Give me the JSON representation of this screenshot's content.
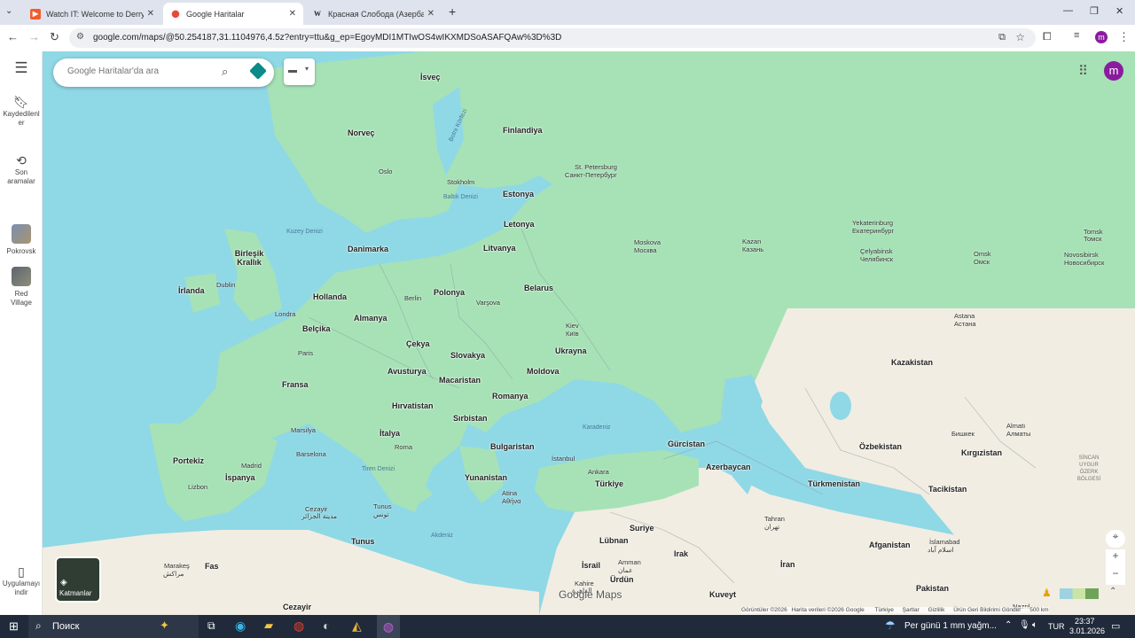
{
  "tabs": [
    {
      "title": "Watch IT: Welcome to Derry Se",
      "active": false
    },
    {
      "title": "Google Haritalar",
      "active": true
    },
    {
      "title": "Красная Слобода (Азербайдж",
      "active": false
    }
  ],
  "address": {
    "url": "google.com/maps/@50.254187,31.1104976,4.5z?entry=ttu&g_ep=EgoyMDI1MTIwOS4wIKXMDSoASAFQAw%3D%3D"
  },
  "search": {
    "placeholder": "Google Haritalar'da ara"
  },
  "rail": {
    "menu": "",
    "saved": "Kaydedilenler",
    "recent": "Son aramalar",
    "pokrovsk": "Pokrovsk",
    "redvillage": "Red Village",
    "getapp": "Uygulamayı indir"
  },
  "account_initial": "m",
  "layers_label": "Katmanlar",
  "map": {
    "countries": [
      {
        "name": "İsveç"
      },
      {
        "name": "Norveç"
      },
      {
        "name": "Finlandiya"
      },
      {
        "name": "Estonya"
      },
      {
        "name": "Letonya"
      },
      {
        "name": "Litvanya"
      },
      {
        "name": "Danimarka"
      },
      {
        "name": "Birleşik Krallık"
      },
      {
        "name": "İrlanda"
      },
      {
        "name": "Hollanda"
      },
      {
        "name": "Polonya"
      },
      {
        "name": "Belarus"
      },
      {
        "name": "Almanya"
      },
      {
        "name": "Belçika"
      },
      {
        "name": "Çekya"
      },
      {
        "name": "Slovakya"
      },
      {
        "name": "Ukrayna"
      },
      {
        "name": "Fransa"
      },
      {
        "name": "Avusturya"
      },
      {
        "name": "Macaristan"
      },
      {
        "name": "Moldova"
      },
      {
        "name": "Romanya"
      },
      {
        "name": "Hırvatistan"
      },
      {
        "name": "Sırbistan"
      },
      {
        "name": "İtalya"
      },
      {
        "name": "Bulgaristan"
      },
      {
        "name": "Portekiz"
      },
      {
        "name": "İspanya"
      },
      {
        "name": "Yunanistan"
      },
      {
        "name": "Türkiye"
      },
      {
        "name": "Gürcistan"
      },
      {
        "name": "Azerbaycan"
      },
      {
        "name": "Kazakistan"
      },
      {
        "name": "Özbekistan"
      },
      {
        "name": "Kırgızistan"
      },
      {
        "name": "Türkmenistan"
      },
      {
        "name": "Tacikistan"
      },
      {
        "name": "Suriye"
      },
      {
        "name": "Irak"
      },
      {
        "name": "İran"
      },
      {
        "name": "Afganistan"
      },
      {
        "name": "Pakistan"
      },
      {
        "name": "Tunus"
      },
      {
        "name": "Lübnan"
      },
      {
        "name": "İsrail"
      },
      {
        "name": "Ürdün"
      },
      {
        "name": "Kuveyt"
      },
      {
        "name": "Fas"
      },
      {
        "name": "Cezayir"
      }
    ],
    "cities": [
      {
        "name": "Oslo"
      },
      {
        "name": "Stokholm"
      },
      {
        "name": "St. Petersburg"
      },
      {
        "name": "Санкт-Петербург"
      },
      {
        "name": "Moskova"
      },
      {
        "name": "Москва"
      },
      {
        "name": "Kazan"
      },
      {
        "name": "Казань"
      },
      {
        "name": "Yekaterinburg"
      },
      {
        "name": "Екатеринбург"
      },
      {
        "name": "Çelyabinsk"
      },
      {
        "name": "Челябинск"
      },
      {
        "name": "Omsk"
      },
      {
        "name": "Омск"
      },
      {
        "name": "Novosibirsk"
      },
      {
        "name": "Новосибирск"
      },
      {
        "name": "Tomsk"
      },
      {
        "name": "Томск"
      },
      {
        "name": "Dublin"
      },
      {
        "name": "Londra"
      },
      {
        "name": "Berlin"
      },
      {
        "name": "Varşova"
      },
      {
        "name": "Kiev"
      },
      {
        "name": "Київ"
      },
      {
        "name": "Paris"
      },
      {
        "name": "Marsilya"
      },
      {
        "name": "Barselona"
      },
      {
        "name": "Madrid"
      },
      {
        "name": "Lizbon"
      },
      {
        "name": "Roma"
      },
      {
        "name": "İstanbul"
      },
      {
        "name": "Ankara"
      },
      {
        "name": "Atina"
      },
      {
        "name": "Αθήνα"
      },
      {
        "name": "Cezayir"
      },
      {
        "name": "مدينة الجزائر"
      },
      {
        "name": "Tunus"
      },
      {
        "name": "تونس"
      },
      {
        "name": "Astana"
      },
      {
        "name": "Астана"
      },
      {
        "name": "Almatı"
      },
      {
        "name": "Бишкек"
      },
      {
        "name": "Алматы"
      },
      {
        "name": "Tahran"
      },
      {
        "name": "تهران"
      },
      {
        "name": "İslamabad"
      },
      {
        "name": "اسلام آباد"
      },
      {
        "name": "Amman"
      },
      {
        "name": "عمان"
      },
      {
        "name": "Kahire"
      },
      {
        "name": "القاهرة"
      },
      {
        "name": "Marakeş"
      },
      {
        "name": "مراكش"
      },
      {
        "name": "Nazrıl"
      }
    ],
    "seas": [
      {
        "name": "Baltık Denizi"
      },
      {
        "name": "Kuzey Denizi"
      },
      {
        "name": "Karadeniz"
      },
      {
        "name": "Tiren Denizi"
      },
      {
        "name": "Akdeniz"
      },
      {
        "name": "Botni Körfezi"
      }
    ],
    "region_label": "SİNCAN UYGUR ÖZERK BÖLGESİ"
  },
  "watermark": "Google Maps",
  "attribution": {
    "imagery": "Görüntüler ©2026",
    "mapdata": "Harita verileri ©2026 Google",
    "country": "Türkiye",
    "terms": "Şartlar",
    "privacy": "Gizlilik",
    "feedback": "Ürün Geri Bildirimi Gönder",
    "scale": "500 km"
  },
  "taskbar": {
    "search": "Поиск",
    "weather": "Per günü 1 mm yağm...",
    "lang": "TUR",
    "time": "23:37",
    "date": "3.01.2026"
  },
  "colors": {
    "land": "#a6e2b6",
    "water": "#8fd8e6",
    "desert": "#f1ede2",
    "accent": "#1a73e8",
    "avatar": "#8b1b9e"
  }
}
